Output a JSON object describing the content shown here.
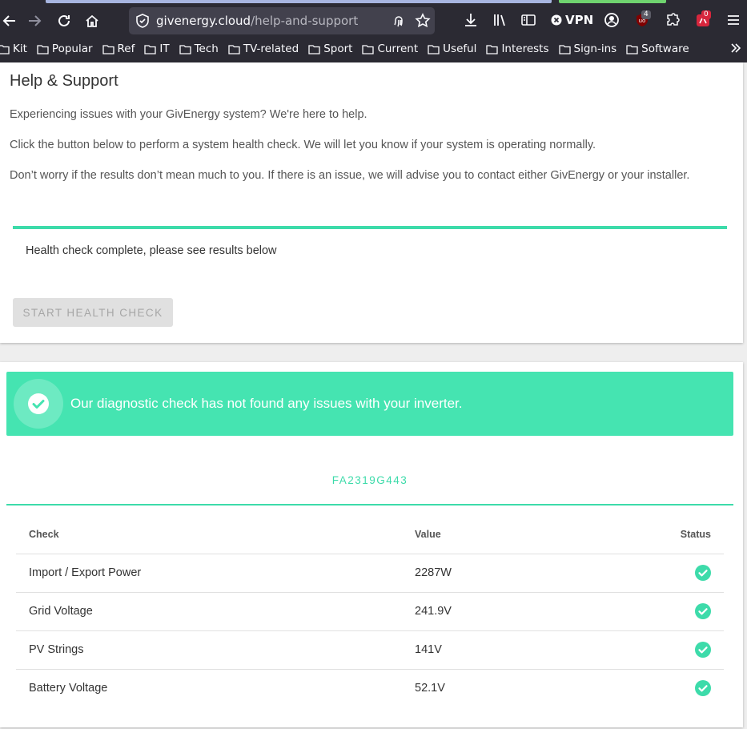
{
  "browser": {
    "url_domain": "givenergy.cloud",
    "url_path": "/help-and-support",
    "vpn_label": "VPN",
    "ublock_count": "4",
    "ext_badge": "0",
    "bookmarks": [
      "Kit",
      "Popular",
      "Ref",
      "IT",
      "Tech",
      "TV-related",
      "Sport",
      "Current",
      "Useful",
      "Interests",
      "Sign-ins",
      "Software"
    ]
  },
  "help": {
    "title": "Help & Support",
    "intro": "Experiencing issues with your GivEnergy system? We're here to help.",
    "instruction": "Click the button below to perform a system health check. We will let you know if your system is operating normally.",
    "reassurance": "Don’t worry if the results don’t mean much to you. If there is an issue, we will advise you to contact either GivEnergy or your installer.",
    "health_status": "Health check complete, please see results below",
    "start_button": "START HEALTH CHECK"
  },
  "results": {
    "banner": "Our diagnostic check has not found any issues with your inverter.",
    "serial": "FA2319G443",
    "columns": {
      "check": "Check",
      "value": "Value",
      "status": "Status"
    },
    "rows": [
      {
        "check": "Import / Export Power",
        "value": "2287W",
        "status": "ok"
      },
      {
        "check": "Grid Voltage",
        "value": "241.9V",
        "status": "ok"
      },
      {
        "check": "PV Strings",
        "value": "141V",
        "status": "ok"
      },
      {
        "check": "Battery Voltage",
        "value": "52.1V",
        "status": "ok"
      }
    ]
  },
  "colors": {
    "accent": "#3ddbaa",
    "banner": "#45e4b1",
    "chrome": "#2b2a33"
  }
}
